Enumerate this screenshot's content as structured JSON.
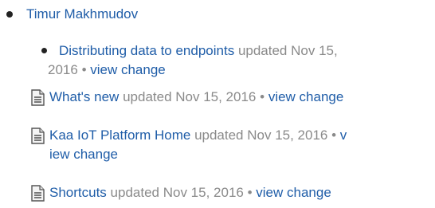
{
  "author": {
    "name": "Timur Makhmudov"
  },
  "child_item": {
    "title": "Distributing data to endpoints",
    "updated_line1": "updated Nov 15,",
    "updated_line2": "2016",
    "sep": "•",
    "link": "view change"
  },
  "items": [
    {
      "title": "What's new",
      "updated": "updated Nov 15, 2016",
      "sep": "•",
      "link": "view change",
      "icon": "page-icon"
    },
    {
      "title": "Kaa IoT Platform Home",
      "updated": "updated Nov 15, 2016",
      "sep": "•",
      "link_part1": "v",
      "link_part2": "iew change",
      "icon": "page-icon"
    },
    {
      "title": "Shortcuts",
      "updated": "updated Nov 15, 2016",
      "sep": "•",
      "link": "view change",
      "icon": "page-icon"
    }
  ]
}
